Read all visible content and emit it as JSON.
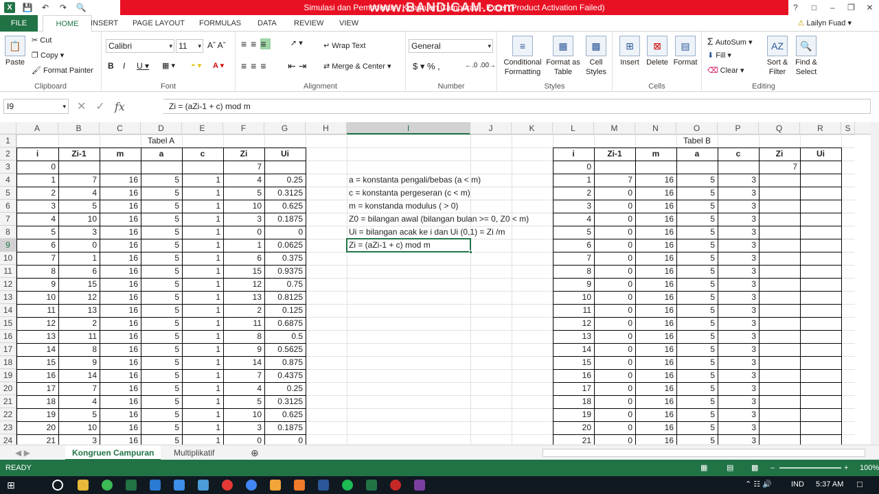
{
  "window": {
    "title": "Simulasi dan Pemodelan - Kongruen Campuran - Excel (Product Activation Failed)",
    "watermark": "www.BANDICAM.com"
  },
  "tabs": [
    "FILE",
    "HOME",
    "INSERT",
    "PAGE LAYOUT",
    "FORMULAS",
    "DATA",
    "REVIEW",
    "VIEW"
  ],
  "user": "Lailyn Fuad",
  "ribbon": {
    "clipboard": {
      "paste": "Paste",
      "cut": "Cut",
      "copy": "Copy",
      "format_painter": "Format Painter",
      "label": "Clipboard"
    },
    "font": {
      "name": "Calibri",
      "size": "11",
      "label": "Font"
    },
    "alignment": {
      "wrap": "Wrap Text",
      "merge": "Merge & Center",
      "label": "Alignment"
    },
    "number": {
      "format": "General",
      "label": "Number"
    },
    "styles": {
      "cond": "Conditional Formatting",
      "table": "Format as Table",
      "cell": "Cell Styles",
      "label": "Styles"
    },
    "cells": {
      "insert": "Insert",
      "delete": "Delete",
      "format": "Format",
      "label": "Cells"
    },
    "editing": {
      "autosum": "AutoSum",
      "fill": "Fill",
      "clear": "Clear",
      "sort": "Sort & Filter",
      "find": "Find & Select",
      "label": "Editing"
    }
  },
  "namebox": "I9",
  "formula": "Zi = (aZi-1 + c) mod m",
  "columns": [
    "A",
    "B",
    "C",
    "D",
    "E",
    "F",
    "G",
    "H",
    "I",
    "J",
    "K",
    "L",
    "M",
    "N",
    "O",
    "P",
    "Q",
    "R",
    "S"
  ],
  "rows": [
    "1",
    "2",
    "3",
    "4",
    "5",
    "6",
    "7",
    "8",
    "9",
    "10",
    "11",
    "12",
    "13",
    "14",
    "15",
    "16",
    "17",
    "18",
    "19",
    "20",
    "21",
    "22",
    "23",
    "24"
  ],
  "tableA": {
    "title": "Tabel A",
    "headers": [
      "i",
      "Zi-1",
      "m",
      "a",
      "c",
      "Zi",
      "Ui"
    ],
    "row0": {
      "i": "0",
      "zi": "7"
    },
    "rows": [
      [
        "1",
        "7",
        "16",
        "5",
        "1",
        "4",
        "0.25"
      ],
      [
        "2",
        "4",
        "16",
        "5",
        "1",
        "5",
        "0.3125"
      ],
      [
        "3",
        "5",
        "16",
        "5",
        "1",
        "10",
        "0.625"
      ],
      [
        "4",
        "10",
        "16",
        "5",
        "1",
        "3",
        "0.1875"
      ],
      [
        "5",
        "3",
        "16",
        "5",
        "1",
        "0",
        "0"
      ],
      [
        "6",
        "0",
        "16",
        "5",
        "1",
        "1",
        "0.0625"
      ],
      [
        "7",
        "1",
        "16",
        "5",
        "1",
        "6",
        "0.375"
      ],
      [
        "8",
        "6",
        "16",
        "5",
        "1",
        "15",
        "0.9375"
      ],
      [
        "9",
        "15",
        "16",
        "5",
        "1",
        "12",
        "0.75"
      ],
      [
        "10",
        "12",
        "16",
        "5",
        "1",
        "13",
        "0.8125"
      ],
      [
        "11",
        "13",
        "16",
        "5",
        "1",
        "2",
        "0.125"
      ],
      [
        "12",
        "2",
        "16",
        "5",
        "1",
        "11",
        "0.6875"
      ],
      [
        "13",
        "11",
        "16",
        "5",
        "1",
        "8",
        "0.5"
      ],
      [
        "14",
        "8",
        "16",
        "5",
        "1",
        "9",
        "0.5625"
      ],
      [
        "15",
        "9",
        "16",
        "5",
        "1",
        "14",
        "0.875"
      ],
      [
        "16",
        "14",
        "16",
        "5",
        "1",
        "7",
        "0.4375"
      ],
      [
        "17",
        "7",
        "16",
        "5",
        "1",
        "4",
        "0.25"
      ],
      [
        "18",
        "4",
        "16",
        "5",
        "1",
        "5",
        "0.3125"
      ],
      [
        "19",
        "5",
        "16",
        "5",
        "1",
        "10",
        "0.625"
      ],
      [
        "20",
        "10",
        "16",
        "5",
        "1",
        "3",
        "0.1875"
      ],
      [
        "21",
        "3",
        "16",
        "5",
        "1",
        "0",
        "0"
      ]
    ]
  },
  "notes": [
    "a = konstanta pengali/bebas (a < m)",
    "c = konstanta pergeseran (c < m)",
    "m = konstanda modulus ( > 0)",
    "Z0 = bilangan awal (bilangan bulan >= 0, Z0 < m)",
    "Ui = bilangan acak ke i dan Ui (0,1) = Zi /m",
    "Zi = (aZi-1 + c) mod m"
  ],
  "tableB": {
    "title": "Tabel B",
    "headers": [
      "i",
      "Zi-1",
      "m",
      "a",
      "c",
      "Zi",
      "Ui"
    ],
    "row0": {
      "i": "0",
      "zi": "7"
    },
    "rows": [
      [
        "1",
        "7",
        "16",
        "5",
        "3"
      ],
      [
        "2",
        "0",
        "16",
        "5",
        "3"
      ],
      [
        "3",
        "0",
        "16",
        "5",
        "3"
      ],
      [
        "4",
        "0",
        "16",
        "5",
        "3"
      ],
      [
        "5",
        "0",
        "16",
        "5",
        "3"
      ],
      [
        "6",
        "0",
        "16",
        "5",
        "3"
      ],
      [
        "7",
        "0",
        "16",
        "5",
        "3"
      ],
      [
        "8",
        "0",
        "16",
        "5",
        "3"
      ],
      [
        "9",
        "0",
        "16",
        "5",
        "3"
      ],
      [
        "10",
        "0",
        "16",
        "5",
        "3"
      ],
      [
        "11",
        "0",
        "16",
        "5",
        "3"
      ],
      [
        "12",
        "0",
        "16",
        "5",
        "3"
      ],
      [
        "13",
        "0",
        "16",
        "5",
        "3"
      ],
      [
        "14",
        "0",
        "16",
        "5",
        "3"
      ],
      [
        "15",
        "0",
        "16",
        "5",
        "3"
      ],
      [
        "16",
        "0",
        "16",
        "5",
        "3"
      ],
      [
        "17",
        "0",
        "16",
        "5",
        "3"
      ],
      [
        "18",
        "0",
        "16",
        "5",
        "3"
      ],
      [
        "19",
        "0",
        "16",
        "5",
        "3"
      ],
      [
        "20",
        "0",
        "16",
        "5",
        "3"
      ],
      [
        "21",
        "0",
        "16",
        "5",
        "3"
      ]
    ]
  },
  "sheets": [
    "Kongruen Campuran",
    "Multiplikatif"
  ],
  "status": {
    "ready": "READY",
    "zoom": "100%"
  },
  "taskbar": {
    "lang": "IND",
    "time": "5:37 AM"
  }
}
